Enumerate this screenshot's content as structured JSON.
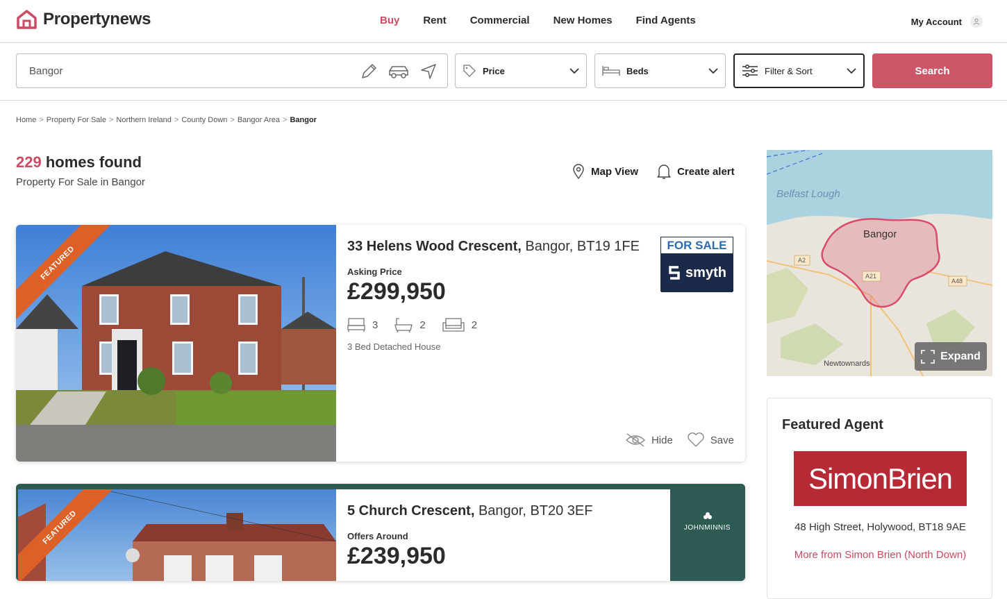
{
  "header": {
    "brand": "Propertynews",
    "nav": [
      {
        "label": "Buy",
        "active": true
      },
      {
        "label": "Rent"
      },
      {
        "label": "Commercial"
      },
      {
        "label": "New Homes"
      },
      {
        "label": "Find Agents"
      }
    ],
    "account_label": "My Account"
  },
  "search": {
    "location_value": "Bangor",
    "price_label": "Price",
    "beds_label": "Beds",
    "filter_label": "Filter & Sort",
    "search_label": "Search"
  },
  "breadcrumb": [
    "Home",
    "Property For Sale",
    "Northern Ireland",
    "County Down",
    "Bangor Area",
    "Bangor"
  ],
  "results": {
    "count": "229",
    "count_suffix": "homes found",
    "subtitle": "Property For Sale in Bangor",
    "map_view_label": "Map View",
    "create_alert_label": "Create alert"
  },
  "listings": [
    {
      "badge": "FEATURED",
      "address_bold": "33 Helens Wood Crescent,",
      "address_rest": " Bangor, BT19 1FE",
      "price_label": "Asking Price",
      "price": "£299,950",
      "beds": "3",
      "baths": "2",
      "receptions": "2",
      "type": "3 Bed Detached House",
      "agent_status": "FOR SALE",
      "agent_name": "smyth",
      "hide_label": "Hide",
      "save_label": "Save"
    },
    {
      "badge": "FEATURED",
      "address_bold": "5 Church Crescent,",
      "address_rest": " Bangor, BT20 3EF",
      "price_label": "Offers Around",
      "price": "£239,950",
      "agent_name": "JOHNMINNIS"
    }
  ],
  "map": {
    "place_main": "Bangor",
    "place_water": "Belfast Lough",
    "place_south": "Newtownards",
    "roads": [
      "A2",
      "A21",
      "A48"
    ],
    "expand_label": "Expand"
  },
  "featured_agent": {
    "title": "Featured Agent",
    "logo_text": "SimonBrien",
    "address": "48 High Street, Holywood, BT18 9AE",
    "more_link": "More from Simon Brien (North Down)"
  },
  "colors": {
    "accent": "#cc4b62",
    "search_button": "#cc5568",
    "ribbon": "#dd6026",
    "agent_navy": "#1c2a4a",
    "simonbrien_red": "#b52a34",
    "johnminnis_green": "#2d5a52"
  }
}
